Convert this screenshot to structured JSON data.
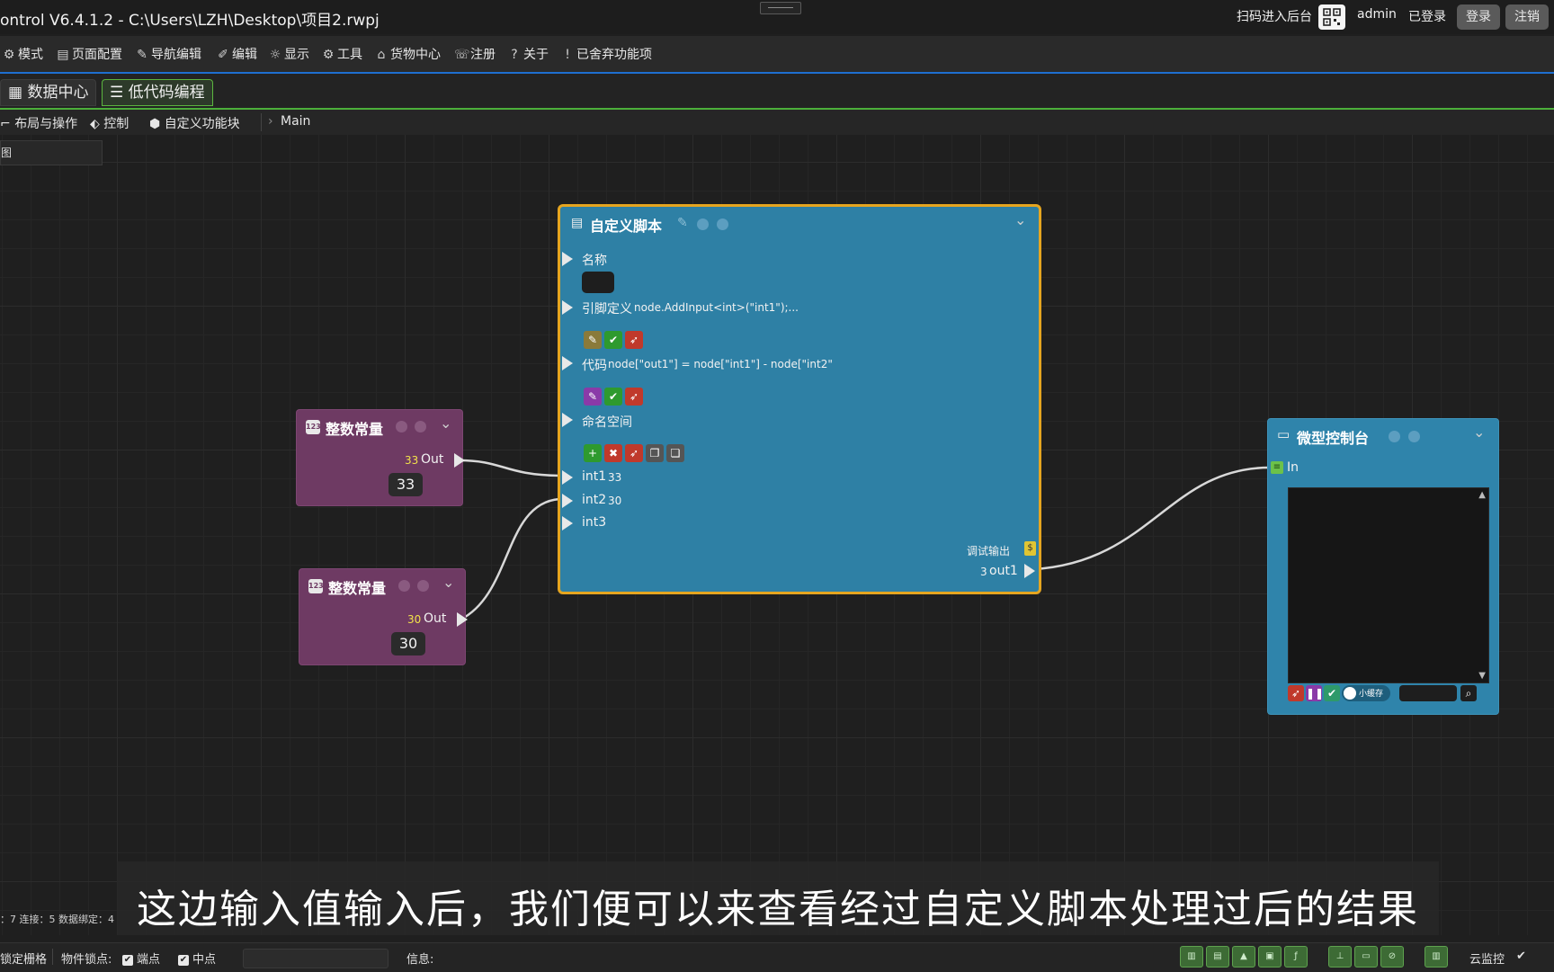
{
  "titlebar": {
    "title": "ontrol V6.4.1.2  -  C:\\Users\\LZH\\Desktop\\项目2.rwpj",
    "scan_text": "扫码进入后台",
    "user": "admin",
    "login_status": "已登录",
    "login_button": "登录",
    "logout_button": "注销"
  },
  "menu": [
    {
      "icon": "gear-icon",
      "glyph": "⚙",
      "label": "模式"
    },
    {
      "icon": "page-icon",
      "glyph": "▤",
      "label": "页面配置"
    },
    {
      "icon": "pen-icon",
      "glyph": "✎",
      "label": "导航编辑"
    },
    {
      "icon": "edit-icon",
      "glyph": "✐",
      "label": "编辑"
    },
    {
      "icon": "display-icon",
      "glyph": "☼",
      "label": "显示"
    },
    {
      "icon": "tools-icon",
      "glyph": "⚙",
      "label": "工具"
    },
    {
      "icon": "home-icon",
      "glyph": "⌂",
      "label": "货物中心"
    },
    {
      "icon": "phone-icon",
      "glyph": "☏",
      "label": "注册"
    },
    {
      "icon": "question-icon",
      "glyph": "?",
      "label": "关于"
    },
    {
      "icon": "info-icon",
      "glyph": "!",
      "label": "已舍弃功能项"
    }
  ],
  "tabs": [
    {
      "icon": "calendar-icon",
      "glyph": "▦",
      "label": "数据中心"
    },
    {
      "icon": "code-icon",
      "glyph": "☰",
      "label": "低代码编程"
    }
  ],
  "subbar": {
    "items": [
      {
        "icon": "layout-icon",
        "glyph": "⌐",
        "label": "布局与操作"
      },
      {
        "icon": "control-icon",
        "glyph": "⬖",
        "label": "控制"
      },
      {
        "icon": "cube-icon",
        "glyph": "⬢",
        "label": "自定义功能块"
      }
    ],
    "breadcrumb": "Main",
    "left_stub": "图"
  },
  "nodes": {
    "const1": {
      "title": "整数常量",
      "out_value": "33",
      "out_label": "Out",
      "value": "33"
    },
    "const2": {
      "title": "整数常量",
      "out_value": "30",
      "out_label": "Out",
      "value": "30"
    },
    "script": {
      "title": "自定义脚本",
      "name_label": "名称",
      "pin_def_label": "引脚定义",
      "pin_def_code": "node.AddInput<int>(\"int1\");...",
      "code_label": "代码",
      "code_text": "node[\"out1\"] = node[\"int1\"] - node[\"int2\"",
      "namespace_label": "命名空间",
      "inputs": [
        {
          "name": "int1",
          "value": "33"
        },
        {
          "name": "int2",
          "value": "30"
        },
        {
          "name": "int3",
          "value": ""
        }
      ],
      "debug_label": "调试输出",
      "out_value": "3",
      "out_label": "out1"
    },
    "console": {
      "title": "微型控制台",
      "in_label": "In",
      "toggle_label": "小缓存"
    }
  },
  "subtitle": "这边输入值输入后，我们便可以来查看经过自定义脚本处理过后的结果",
  "stats": "：7    连接：5    数据绑定：4",
  "status": {
    "grid_lock": "锁定栅格",
    "snap": "物件锁点:",
    "endpoint": "端点",
    "midpoint": "中点",
    "info": "信息:",
    "cloud": "云监控"
  },
  "colors": {
    "accent_blue": "#1e6fd0",
    "tab_green": "#5cb63f",
    "script_border": "#e5a520",
    "const_node": "#6e3a63",
    "script_node": "#2e80a5",
    "value_yellow": "#f2e24a"
  }
}
